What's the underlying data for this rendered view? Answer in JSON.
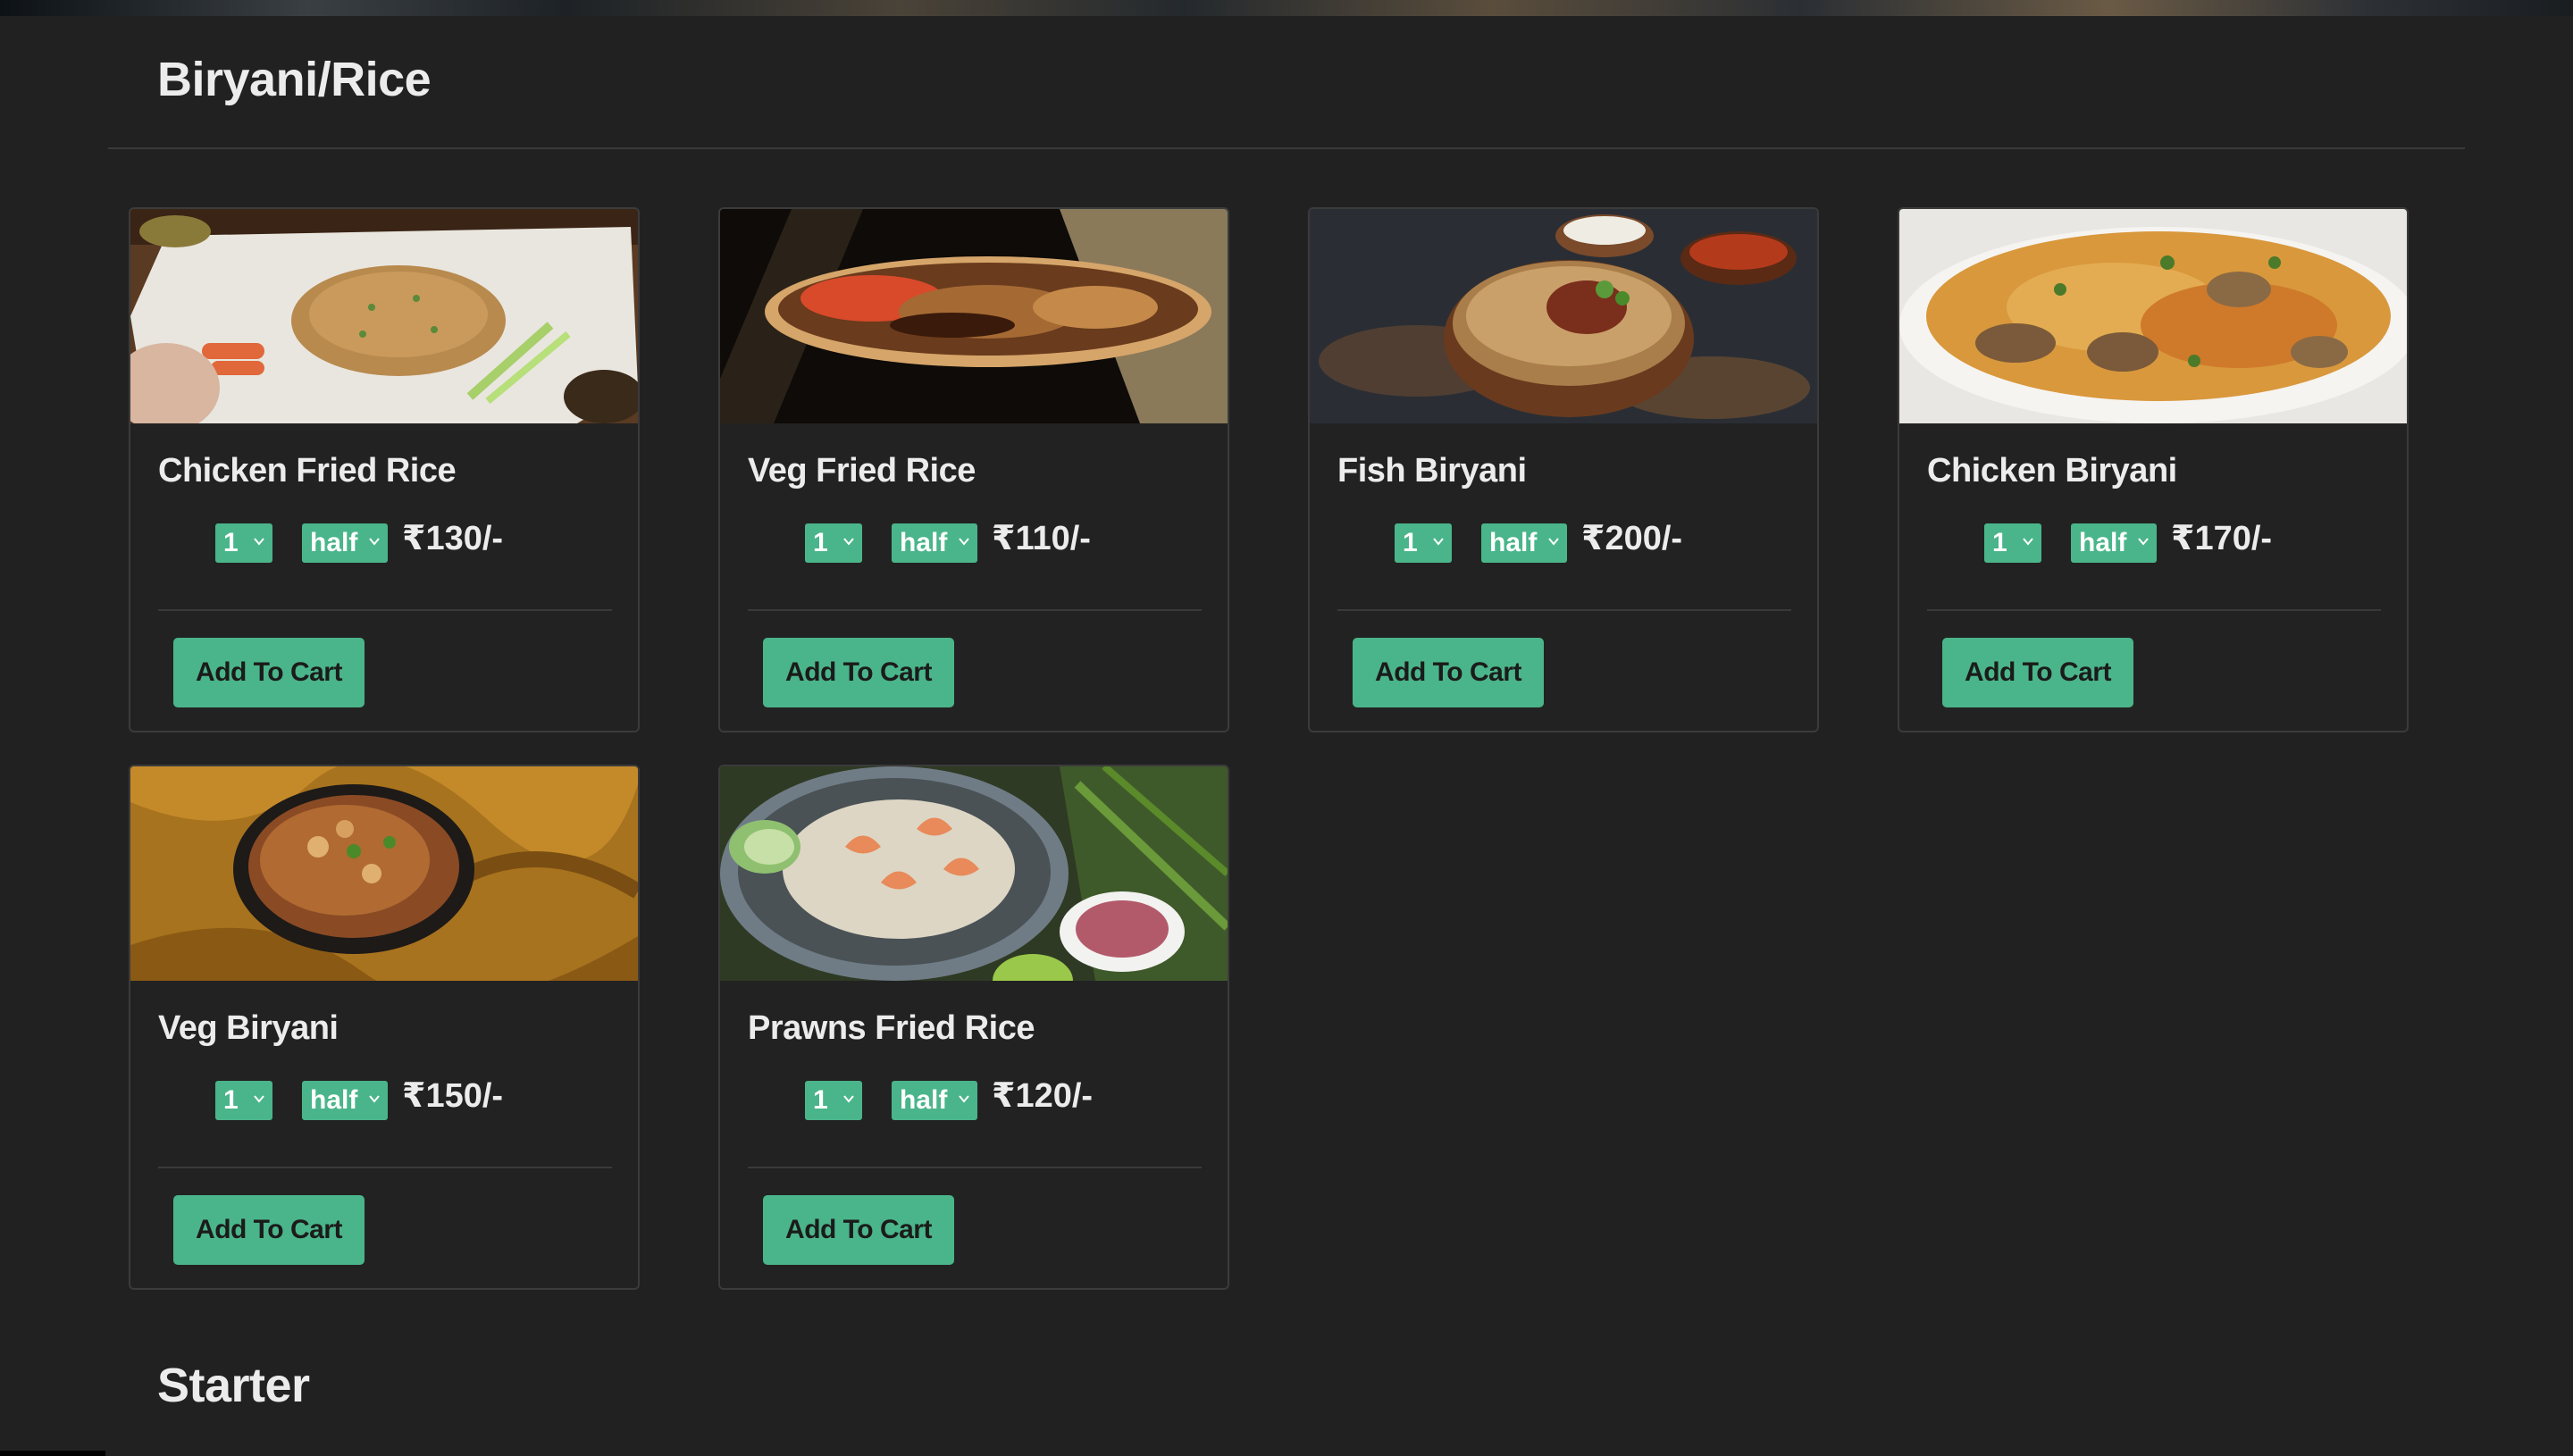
{
  "sections": {
    "biryani_title": "Biryani/Rice",
    "starter_title": "Starter"
  },
  "select_options": {
    "qty": "1",
    "size": "half"
  },
  "button_label": "Add To Cart",
  "accent_color": "#4ab58a",
  "items": [
    {
      "name": "Chicken Fried Rice",
      "qty": "1",
      "size": "half",
      "price": "₹130/-",
      "image": "fried-rice-plate-photo"
    },
    {
      "name": "Veg Fried Rice",
      "qty": "1",
      "size": "half",
      "price": "₹110/-",
      "image": "veg-fried-rice-dish-photo"
    },
    {
      "name": "Fish Biryani",
      "qty": "1",
      "size": "half",
      "price": "₹200/-",
      "image": "fish-biryani-bowl-photo"
    },
    {
      "name": "Chicken Biryani",
      "qty": "1",
      "size": "half",
      "price": "₹170/-",
      "image": "chicken-biryani-plate-photo"
    },
    {
      "name": "Veg Biryani",
      "qty": "1",
      "size": "half",
      "price": "₹150/-",
      "image": "veg-biryani-pot-photo"
    },
    {
      "name": "Prawns Fried Rice",
      "qty": "1",
      "size": "half",
      "price": "₹120/-",
      "image": "prawns-fried-rice-photo"
    }
  ]
}
